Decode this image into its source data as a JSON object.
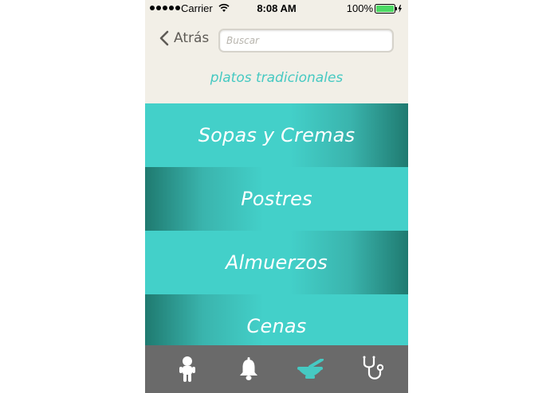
{
  "status_bar": {
    "carrier": "Carrier",
    "time": "8:08 AM",
    "battery": "100%"
  },
  "nav": {
    "back_label": "Atrás",
    "search_placeholder": "Buscar"
  },
  "section_title": "platos tradicionales",
  "categories": [
    {
      "label": "Sopas y Cremas"
    },
    {
      "label": "Postres"
    },
    {
      "label": "Almuerzos"
    },
    {
      "label": "Cenas"
    }
  ],
  "tab_bar": {
    "tabs": [
      {
        "icon": "child-icon"
      },
      {
        "icon": "bell-icon"
      },
      {
        "icon": "mortar-pestle-icon",
        "active": true
      },
      {
        "icon": "stethoscope-icon"
      }
    ]
  },
  "colors": {
    "accent": "#46c9c2",
    "category_bg": "#43d0c9",
    "category_shade": "#1f7a70",
    "tab_bar_bg": "#6a6a6a",
    "tab_active": "#46c9c2",
    "battery": "#4cd964"
  }
}
